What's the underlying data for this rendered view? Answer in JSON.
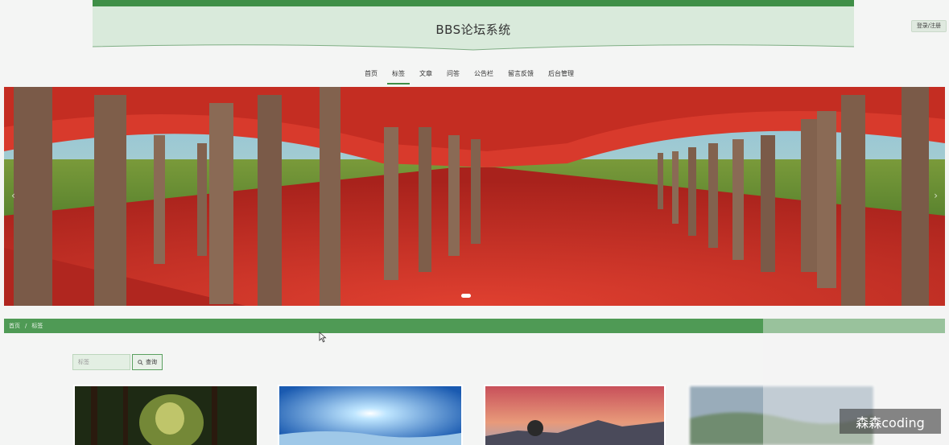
{
  "header": {
    "title": "BBS论坛系统"
  },
  "login_label": "登录/注册",
  "nav": {
    "items": [
      {
        "label": "首页",
        "active": false
      },
      {
        "label": "标签",
        "active": true
      },
      {
        "label": "文章",
        "active": false
      },
      {
        "label": "问答",
        "active": false
      },
      {
        "label": "公告栏",
        "active": false
      },
      {
        "label": "留言反馈",
        "active": false
      },
      {
        "label": "后台管理",
        "active": false
      }
    ]
  },
  "carousel": {
    "prev_icon": "chevron-left-icon",
    "next_icon": "chevron-right-icon",
    "prev": "‹",
    "next": "›"
  },
  "breadcrumb": {
    "home": "首页",
    "separator": "/",
    "current": "标签"
  },
  "search": {
    "placeholder": "标签",
    "button_label": "查询",
    "icon": "search-icon"
  },
  "colors": {
    "accent": "#3f8f47",
    "header_bg": "#d9eadb"
  },
  "watermark": "森森coding"
}
